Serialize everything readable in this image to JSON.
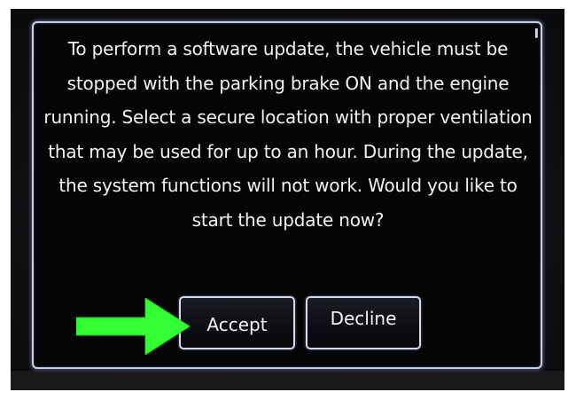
{
  "dialog": {
    "message": "To perform a software update, the vehicle must be stopped with the parking brake ON and the engine running. Select a secure location with proper ventilation that may be used for up to an hour. During the update, the system functions will not work. Would you like to start the update now?",
    "accept_label": "Accept",
    "decline_label": "Decline"
  },
  "icons": {
    "annotation": "green-arrow-icon",
    "corner": "partial-glyph-icon"
  },
  "colors": {
    "screen_background": "#0b0b0d",
    "dialog_border": "#c9cde6",
    "text": "#f2f2f2",
    "arrow": "#33ff33"
  }
}
